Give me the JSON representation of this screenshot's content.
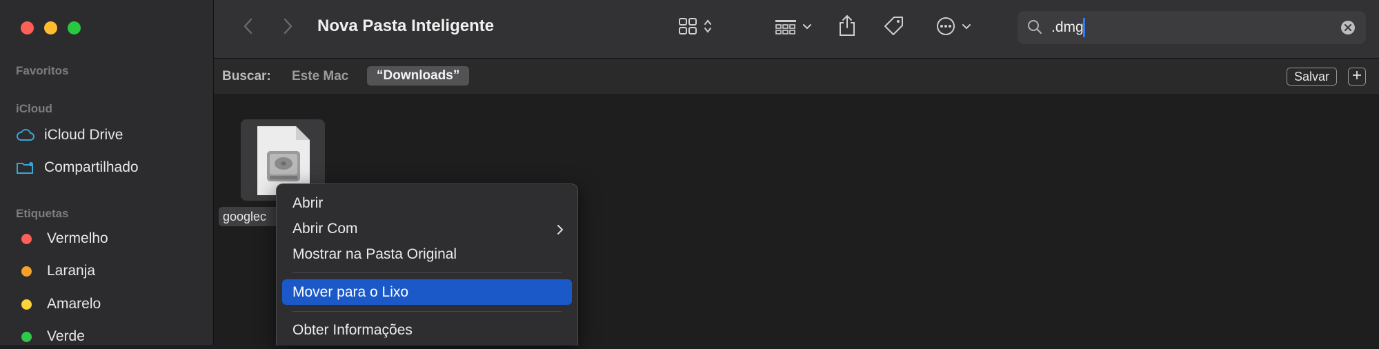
{
  "window": {
    "title": "Nova Pasta Inteligente"
  },
  "sidebar": {
    "sections": {
      "favoritos": "Favoritos",
      "icloud": "iCloud",
      "etiquetas": "Etiquetas"
    },
    "icloud_items": [
      {
        "label": "iCloud Drive",
        "icon": "cloud-icon"
      },
      {
        "label": "Compartilhado",
        "icon": "shared-folder-icon"
      }
    ],
    "tags": [
      {
        "label": "Vermelho",
        "color": "#fe5f57"
      },
      {
        "label": "Laranja",
        "color": "#f7a02c"
      },
      {
        "label": "Amarelo",
        "color": "#fed23a"
      },
      {
        "label": "Verde",
        "color": "#31c74a"
      }
    ]
  },
  "toolbar": {
    "icons": [
      "chevron-left-icon",
      "chevron-right-icon",
      "grid-view-icon",
      "group-icon",
      "share-icon",
      "tag-icon",
      "more-icon"
    ]
  },
  "search": {
    "value": ".dmg"
  },
  "scope": {
    "label": "Buscar:",
    "option_mac": "Este Mac",
    "option_downloads": "“Downloads”",
    "save_label": "Salvar"
  },
  "file": {
    "name": "googlec"
  },
  "context_menu": {
    "items": [
      {
        "label": "Abrir"
      },
      {
        "label": "Abrir Com"
      },
      {
        "label": "Mostrar na Pasta Original"
      },
      {
        "label": "Mover para o Lixo"
      },
      {
        "label": "Obter Informações"
      }
    ]
  },
  "colors": {
    "accent": "#1b59c8",
    "caret": "#2f7cf6"
  }
}
